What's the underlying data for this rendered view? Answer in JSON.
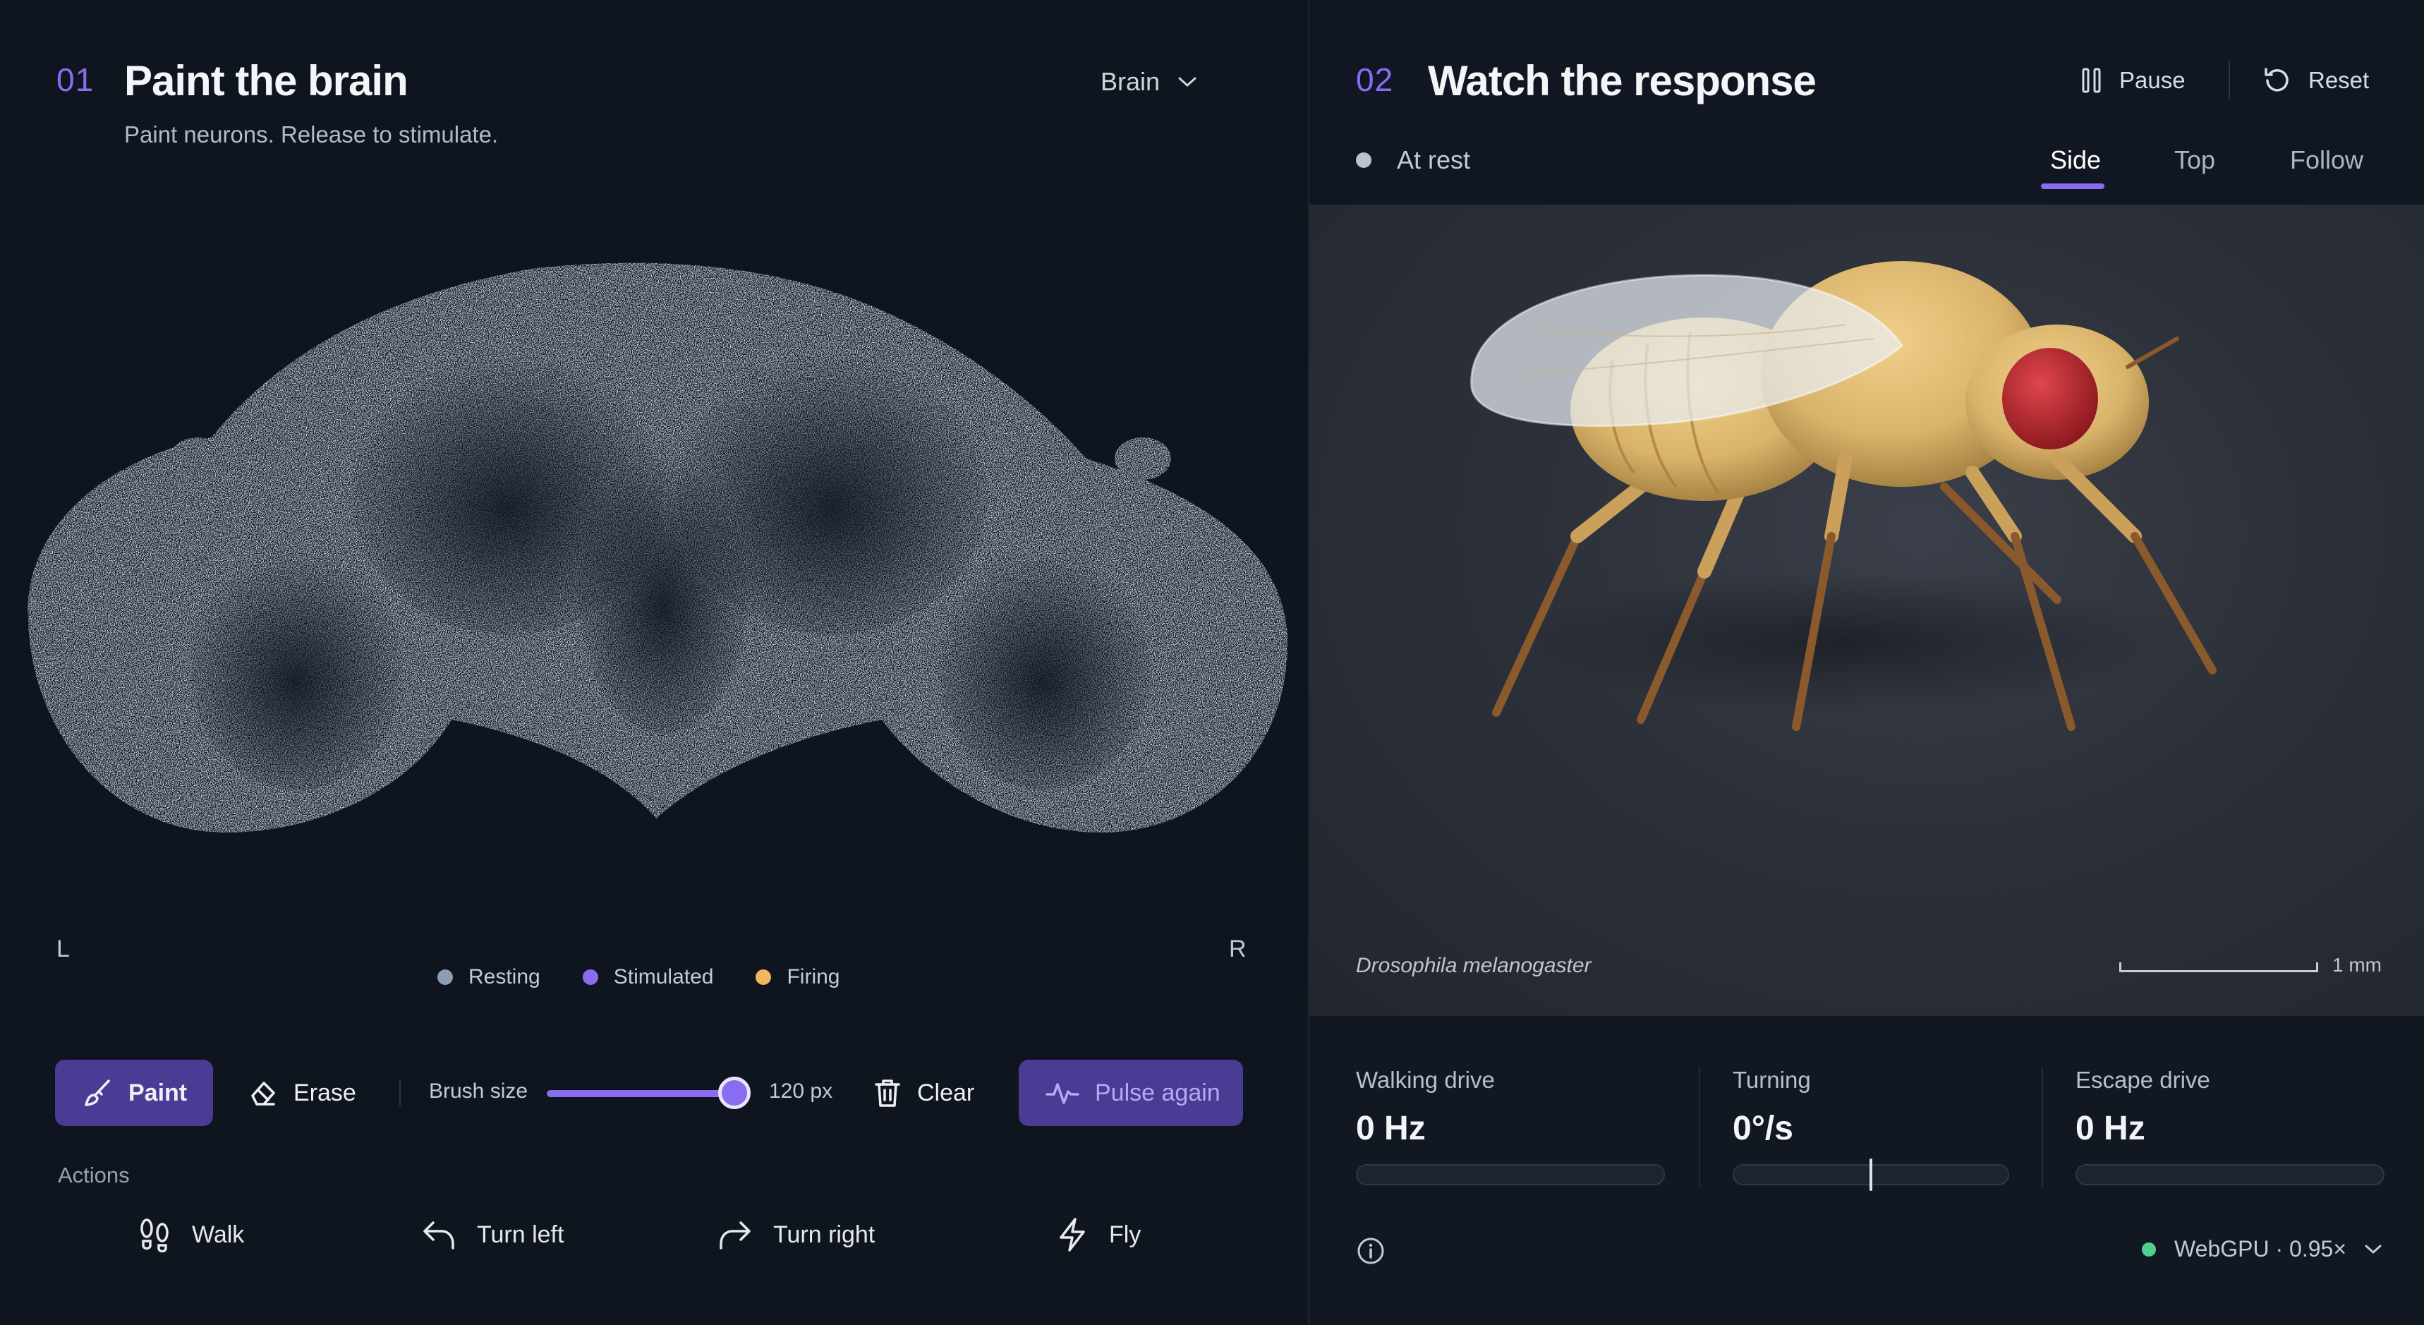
{
  "left_panel": {
    "step_number": "01",
    "title": "Paint the brain",
    "subtitle": "Paint neurons. Release to stimulate.",
    "region_select": {
      "value": "Brain"
    },
    "side_left": "L",
    "side_right": "R",
    "legend": [
      {
        "label": "Resting",
        "color": "#8c9db4"
      },
      {
        "label": "Stimulated",
        "color": "#8a6cf0"
      },
      {
        "label": "Firing",
        "color": "#f2b65c"
      }
    ],
    "toolbar": {
      "paint_label": "Paint",
      "erase_label": "Erase",
      "brush_size_label": "Brush size",
      "brush_size_value": "120 px",
      "brush_size_fraction": 1.0,
      "clear_label": "Clear",
      "pulse_label": "Pulse again"
    },
    "actions_label": "Actions",
    "actions": [
      {
        "label": "Walk",
        "icon": "footprints-icon"
      },
      {
        "label": "Turn left",
        "icon": "turn-left-icon"
      },
      {
        "label": "Turn right",
        "icon": "turn-right-icon"
      },
      {
        "label": "Fly",
        "icon": "lightning-icon"
      }
    ]
  },
  "right_panel": {
    "step_number": "02",
    "title": "Watch the response",
    "pause_label": "Pause",
    "reset_label": "Reset",
    "status": "At rest",
    "status_color": "#b7c3d3",
    "view_tabs": [
      {
        "label": "Side",
        "active": true
      },
      {
        "label": "Top",
        "active": false
      },
      {
        "label": "Follow",
        "active": false
      }
    ],
    "species": "Drosophila melanogaster",
    "scale_label": "1 mm",
    "metrics": [
      {
        "label": "Walking drive",
        "value": "0 Hz"
      },
      {
        "label": "Turning",
        "value": "0°/s"
      },
      {
        "label": "Escape drive",
        "value": "0 Hz"
      }
    ],
    "backend": {
      "label": "WebGPU · 0.95×",
      "status_color": "#4fd18b"
    }
  },
  "colors": {
    "accent": "#8a6cf0",
    "accent_button": "#4a3b94",
    "fly_body": "#d9b36a",
    "fly_eye": "#c2262e"
  }
}
